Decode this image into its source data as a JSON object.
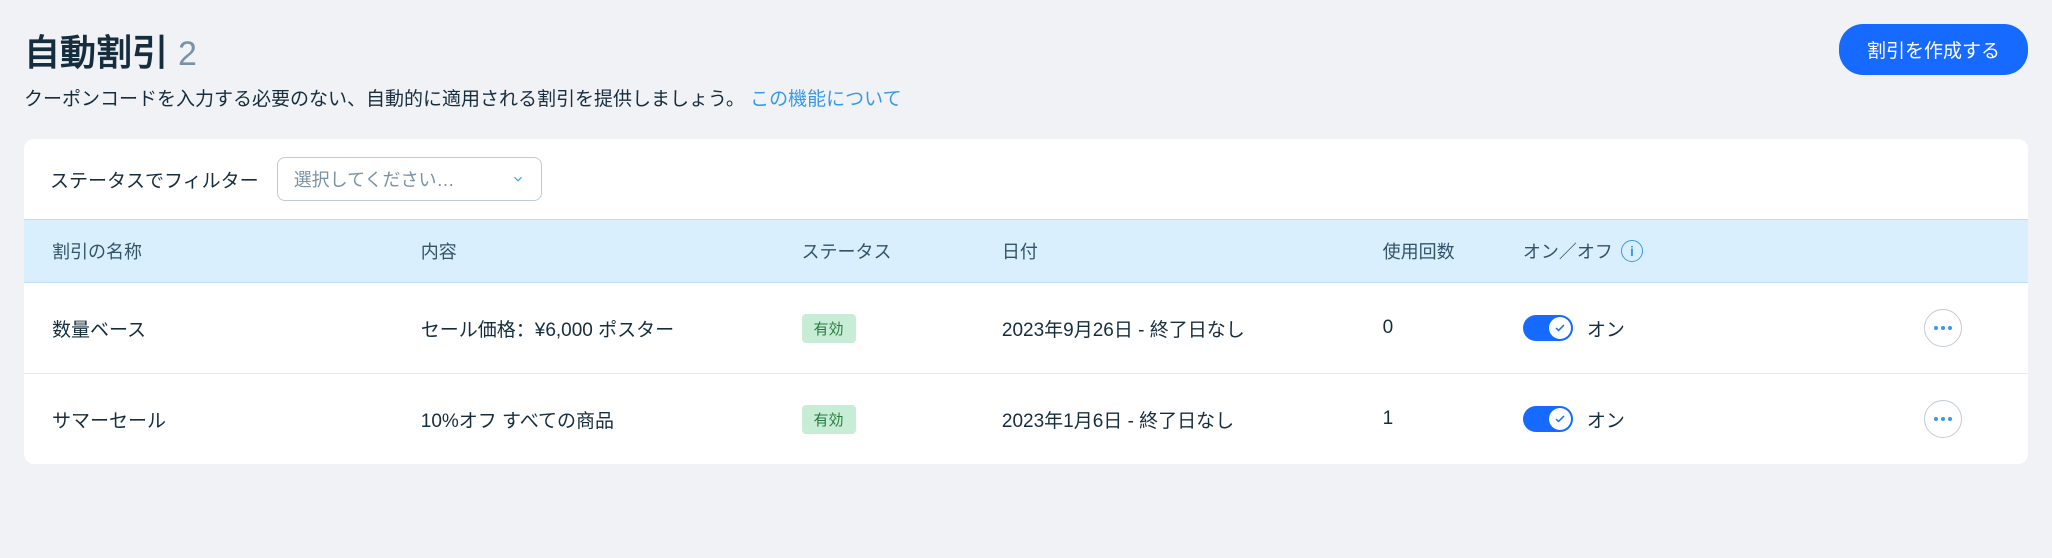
{
  "header": {
    "title": "自動割引",
    "count": "2",
    "subtitle": "クーポンコードを入力する必要のない、自動的に適用される割引を提供しましょう。",
    "learn_more": "この機能について",
    "create_button": "割引を作成する"
  },
  "filter": {
    "label": "ステータスでフィルター",
    "placeholder": "選択してください…"
  },
  "table": {
    "headers": {
      "name": "割引の名称",
      "description": "内容",
      "status": "ステータス",
      "date": "日付",
      "uses": "使用回数",
      "onoff": "オン／オフ"
    },
    "rows": [
      {
        "name": "数量ベース",
        "description": "セール価格：¥6,000 ポスター",
        "status": "有効",
        "date": "2023年9月26日 - 終了日なし",
        "uses": "0",
        "toggle_label": "オン"
      },
      {
        "name": "サマーセール",
        "description": "10%オフ すべての商品",
        "status": "有効",
        "date": "2023年1月6日 - 終了日なし",
        "uses": "1",
        "toggle_label": "オン"
      }
    ]
  },
  "colors": {
    "primary": "#166aff",
    "link": "#3899ec",
    "header_row": "#daeffe",
    "badge_bg": "#c8edd6",
    "badge_text": "#247a3c",
    "body_bg": "#f0f2f5"
  }
}
